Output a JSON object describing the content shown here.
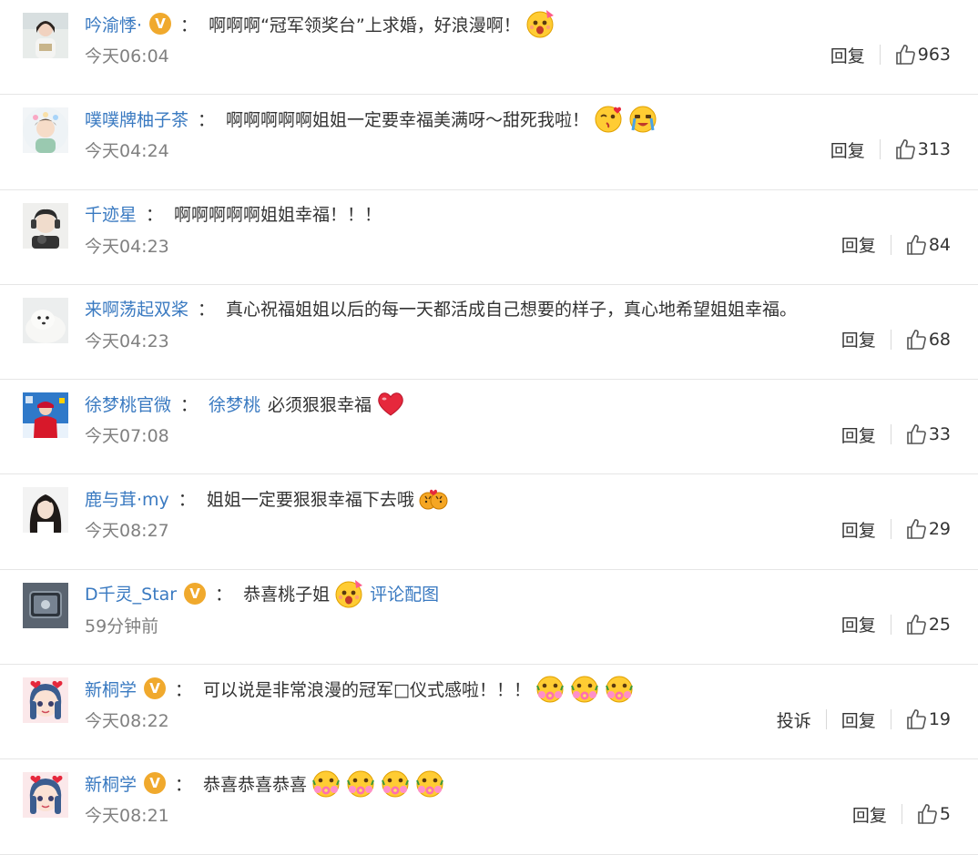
{
  "colors": {
    "username": "#3a7ac1",
    "text": "#333333",
    "time": "#808080",
    "verified_badge": "#f0a92d",
    "divider": "#e6e6e6"
  },
  "labels": {
    "reply": "回复",
    "report": "投诉",
    "colon": "："
  },
  "comments": [
    {
      "user": "吟渝悸·",
      "verified": true,
      "verified_icon": "V",
      "text": "啊啊啊“冠军领奖台”上求婚，好浪漫啊！",
      "emojis": [
        "party-face"
      ],
      "time": "今天06:04",
      "likes": "963",
      "avatar": "woman-reading"
    },
    {
      "user": "噗噗牌柚子茶",
      "verified": false,
      "text": "啊啊啊啊啊姐姐一定要幸福美满呀～甜死我啦！",
      "emojis": [
        "kiss-face",
        "crying-happy-face"
      ],
      "time": "今天04:24",
      "likes": "313",
      "avatar": "girl-flowers"
    },
    {
      "user": "千迹星",
      "verified": false,
      "text": "啊啊啊啊啊姐姐幸福！！！",
      "emojis": [],
      "time": "今天04:23",
      "likes": "84",
      "avatar": "boy-headphones"
    },
    {
      "user": "来啊荡起双桨",
      "verified": false,
      "text": "真心祝福姐姐以后的每一天都活成自己想要的样子，真心地希望姐姐幸福。",
      "emojis": [],
      "time": "今天04:23",
      "likes": "68",
      "avatar": "seal-pup"
    },
    {
      "user": "徐梦桃官微",
      "verified": false,
      "mention": "徐梦桃",
      "text": "必须狠狠幸福",
      "emojis": [
        "red-heart"
      ],
      "time": "今天07:08",
      "likes": "33",
      "avatar": "skier-red"
    },
    {
      "user": "鹿与茸·my",
      "verified": false,
      "text": "姐姐一定要狠狠幸福下去哦",
      "emojis": [
        "couple-tigers"
      ],
      "time": "今天08:27",
      "likes": "29",
      "avatar": "woman-portrait"
    },
    {
      "user": "D千灵_Star",
      "verified": true,
      "verified_icon": "V",
      "text": "恭喜桃子姐",
      "emojis": [
        "party-face"
      ],
      "link": "评论配图",
      "time": "59分钟前",
      "likes": "25",
      "avatar": "tv-screen"
    },
    {
      "user": "新桐学",
      "verified": true,
      "verified_icon": "V",
      "text": "可以说是非常浪漫的冠军□仪式感啦！！！",
      "emojis": [
        "flower-face",
        "flower-face",
        "flower-face"
      ],
      "time": "今天08:22",
      "likes": "19",
      "report": true,
      "avatar": "anime-girl"
    },
    {
      "user": "新桐学",
      "verified": true,
      "verified_icon": "V",
      "text": "恭喜恭喜恭喜",
      "emojis": [
        "flower-face",
        "flower-face",
        "flower-face",
        "flower-face"
      ],
      "time": "今天08:21",
      "likes": "5",
      "avatar": "anime-girl"
    }
  ]
}
